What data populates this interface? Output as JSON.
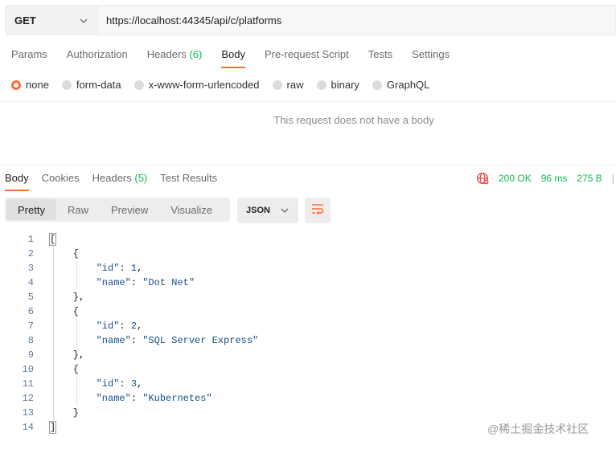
{
  "request": {
    "method": "GET",
    "url": "https://localhost:44345/api/c/platforms",
    "tabs": [
      {
        "label": "Params"
      },
      {
        "label": "Authorization"
      },
      {
        "label": "Headers",
        "count": "(6)"
      },
      {
        "label": "Body"
      },
      {
        "label": "Pre-request Script"
      },
      {
        "label": "Tests"
      },
      {
        "label": "Settings"
      }
    ],
    "active_tab": "Body",
    "body_types": [
      "none",
      "form-data",
      "x-www-form-urlencoded",
      "raw",
      "binary",
      "GraphQL"
    ],
    "selected_body_type": "none",
    "no_body_message": "This request does not have a body"
  },
  "response": {
    "tabs": [
      {
        "label": "Body"
      },
      {
        "label": "Cookies"
      },
      {
        "label": "Headers",
        "count": "(5)"
      },
      {
        "label": "Test Results"
      }
    ],
    "active_tab": "Body",
    "status": "200 OK",
    "time": "96 ms",
    "size": "275 B",
    "view_modes": [
      "Pretty",
      "Raw",
      "Preview",
      "Visualize"
    ],
    "active_view": "Pretty",
    "format": "JSON",
    "code_lines": [
      {
        "n": "1",
        "text": "["
      },
      {
        "n": "2",
        "text": "    {"
      },
      {
        "n": "3",
        "key": "\"id\"",
        "sep": ": ",
        "val": "1",
        "end": ","
      },
      {
        "n": "4",
        "key": "\"name\"",
        "sep": ": ",
        "val": "\"Dot Net\"",
        "end": ""
      },
      {
        "n": "5",
        "text": "    },"
      },
      {
        "n": "6",
        "text": "    {"
      },
      {
        "n": "7",
        "key": "\"id\"",
        "sep": ": ",
        "val": "2",
        "end": ","
      },
      {
        "n": "8",
        "key": "\"name\"",
        "sep": ": ",
        "val": "\"SQL Server Express\"",
        "end": ""
      },
      {
        "n": "9",
        "text": "    },"
      },
      {
        "n": "10",
        "text": "    {"
      },
      {
        "n": "11",
        "key": "\"id\"",
        "sep": ": ",
        "val": "3",
        "end": ","
      },
      {
        "n": "12",
        "key": "\"name\"",
        "sep": ": ",
        "val": "\"Kubernetes\"",
        "end": ""
      },
      {
        "n": "13",
        "text": "    }"
      },
      {
        "n": "14",
        "text": "]"
      }
    ]
  },
  "watermark": "@稀土掘金技术社区",
  "colors": {
    "accent": "#ff6c37",
    "success": "#0cbb52",
    "error_icon": "#e24c4b"
  }
}
